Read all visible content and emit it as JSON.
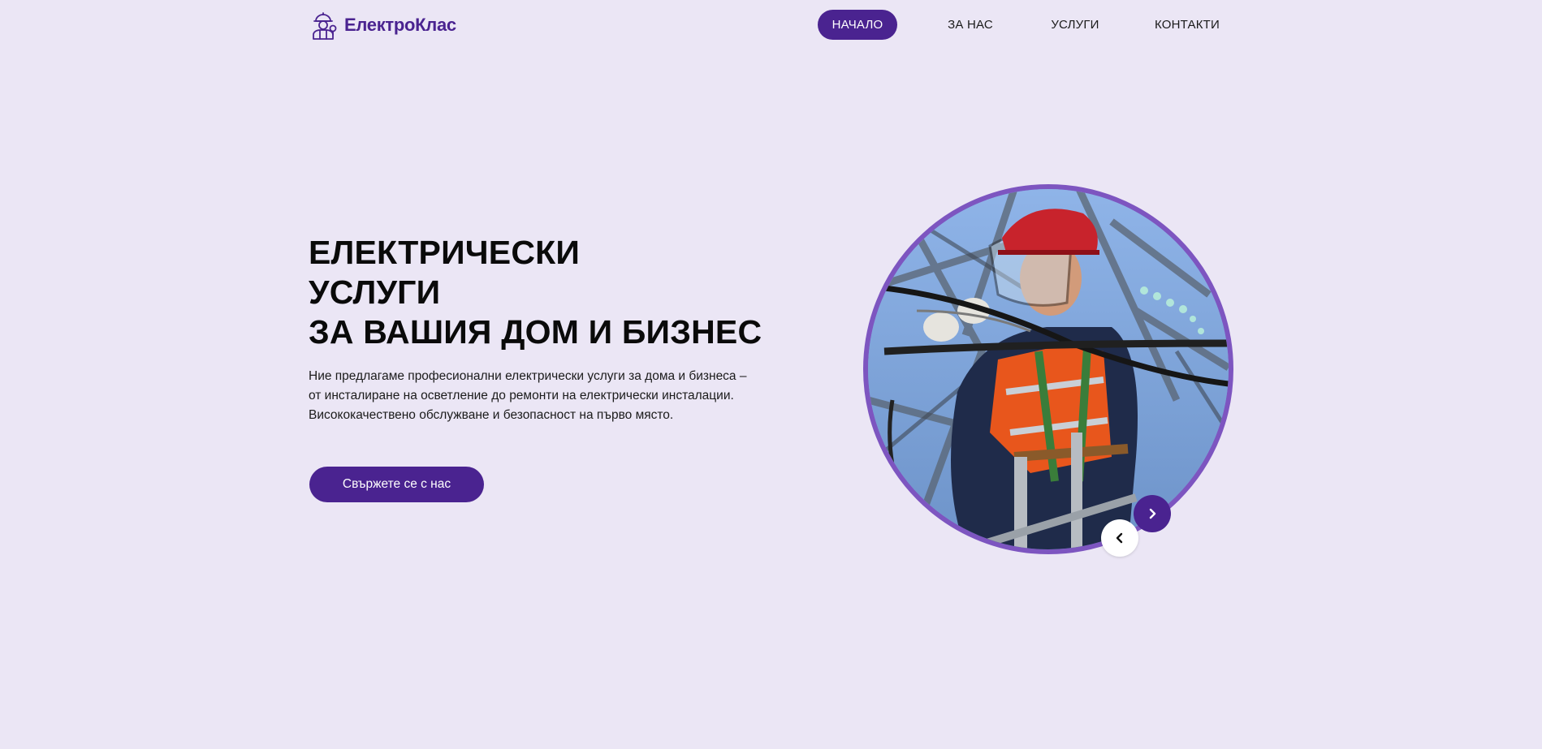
{
  "brand": {
    "name": "ЕлектроКлас",
    "logo_icon": "electrician-worker-icon",
    "color": "#4a2390"
  },
  "nav": {
    "items": [
      {
        "label": "НАЧАЛО",
        "active": true
      },
      {
        "label": "ЗА НАС",
        "active": false
      },
      {
        "label": "УСЛУГИ",
        "active": false
      },
      {
        "label": "КОНТАКТИ",
        "active": false
      }
    ]
  },
  "hero": {
    "title_lines": [
      "ЕЛЕКТРИЧЕСКИ",
      "УСЛУГИ",
      "ЗА ВАШИЯ ДОМ И БИЗНЕС"
    ],
    "description_lines": [
      "Ние предлагаме професионални електрически услуги за дома и бизнеса –",
      "от инсталиране на осветление до ремонти на електрически инсталации.",
      "Висококачествено обслужване и безопасност на първо място."
    ],
    "cta_label": "Свържете се с нас"
  },
  "carousel": {
    "image": "electrician-working-on-power-line",
    "next_icon": "chevron-right-icon",
    "prev_icon": "chevron-left-icon"
  },
  "colors": {
    "background": "#ebe6f5",
    "accent": "#4a2390",
    "circle_border": "#7d55c0"
  }
}
